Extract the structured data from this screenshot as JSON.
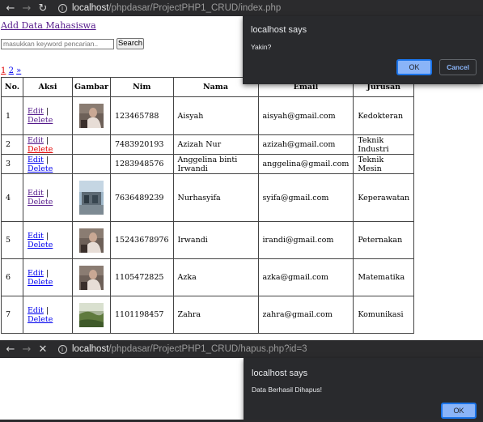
{
  "browser_top": {
    "url_host": "localhost",
    "url_path": "/phpdasar/ProjectPHP1_CRUD/index.php",
    "back_icon": "arrow-left-icon",
    "forward_icon": "arrow-right-icon",
    "reload_icon": "reload-icon"
  },
  "page": {
    "add_link": "Add Data Mahasiswa",
    "search_placeholder": "masukkan keyword pencarian..",
    "search_button": "Search",
    "pager": {
      "current": "1",
      "next": "2",
      "next_arrow": "»"
    },
    "table": {
      "headers": [
        "No.",
        "Aksi",
        "Gambar",
        "Nim",
        "Nama",
        "Email",
        "Jurusan"
      ],
      "edit_label": "Edit",
      "separator": "|",
      "delete_label": "Delete",
      "rows": [
        {
          "no": "1",
          "nim": "123465788",
          "nama": "Aisyah",
          "email": "aisyah@gmail.com",
          "jurusan": "Kedokteran",
          "image": "person-photo"
        },
        {
          "no": "2",
          "nim": "7483920193",
          "nama": "Azizah Nur",
          "email": "azizah@gmail.com",
          "jurusan": "Teknik Industri",
          "image": ""
        },
        {
          "no": "3",
          "nim": "1283948576",
          "nama": "Anggelina binti Irwandi",
          "email": "anggelina@gmail.com",
          "jurusan": "Teknik Mesin",
          "image": ""
        },
        {
          "no": "4",
          "nim": "7636489239",
          "nama": "Nurhasyifa",
          "email": "syifa@gmail.com",
          "jurusan": "Keperawatan",
          "image": "building-photo"
        },
        {
          "no": "5",
          "nim": "15243678976",
          "nama": "Irwandi",
          "email": "irandi@gmail.com",
          "jurusan": "Peternakan",
          "image": "person-photo"
        },
        {
          "no": "6",
          "nim": "1105472825",
          "nama": "Azka",
          "email": "azka@gmail.com",
          "jurusan": "Matematika",
          "image": "person-photo"
        },
        {
          "no": "7",
          "nim": "1101198457",
          "nama": "Zahra",
          "email": "zahra@gmail.com",
          "jurusan": "Komunikasi",
          "image": "landscape-photo"
        }
      ]
    }
  },
  "dialog_confirm": {
    "title": "localhost says",
    "message": "Yakin?",
    "ok": "OK",
    "cancel": "Cancel"
  },
  "browser_bottom": {
    "url_host": "localhost",
    "url_path": "/phpdasar/ProjectPHP1_CRUD/hapus.php?id=3",
    "stop_icon": "close-icon"
  },
  "dialog_alert": {
    "title": "localhost says",
    "message": "Data Berhasil Dihapus!",
    "ok": "OK"
  },
  "colors": {
    "chrome_bg": "#2b2b2d",
    "dialog_bg": "#292a2d",
    "ok_button": "#8ab4f8",
    "visited_link": "#551a8b",
    "active_link": "#e00000"
  }
}
